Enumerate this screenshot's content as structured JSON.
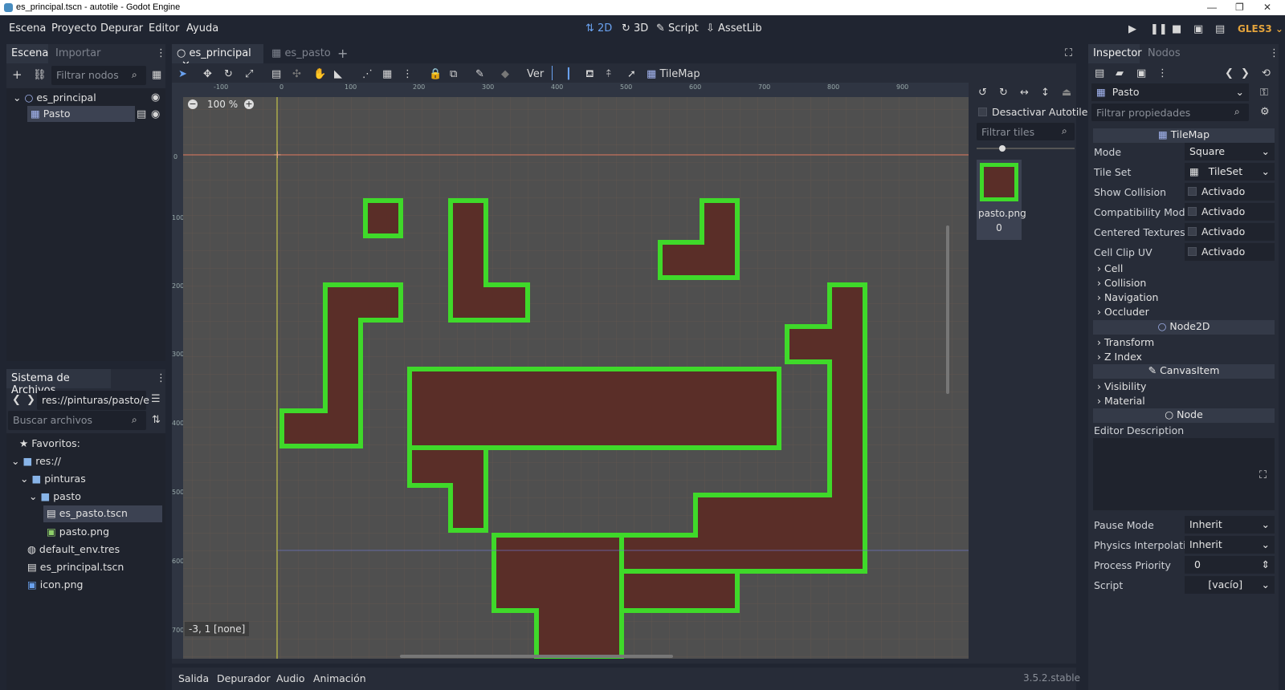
{
  "window": {
    "title": "es_principal.tscn - autotile - Godot Engine",
    "controls": [
      "—",
      "❐",
      "✕"
    ]
  },
  "menu": [
    "Escena",
    "Proyecto",
    "Depurar",
    "Editor",
    "Ayuda"
  ],
  "modes": [
    {
      "label": "2D",
      "icon": "2d-icon"
    },
    {
      "label": "3D",
      "icon": "3d-icon"
    },
    {
      "label": "Script",
      "icon": "script-icon"
    },
    {
      "label": "AssetLib",
      "icon": "assetlib-icon"
    }
  ],
  "renderer": "GLES3",
  "scene_dock": {
    "tabs": [
      "Escena",
      "Importar"
    ],
    "filter_placeholder": "Filtrar nodos",
    "nodes": [
      {
        "name": "es_principal",
        "icon": "node2d-icon"
      },
      {
        "name": "Pasto",
        "icon": "tilemap-icon"
      }
    ]
  },
  "filesystem": {
    "title": "Sistema de Archivos",
    "path": "res://pinturas/pasto/e",
    "search_placeholder": "Buscar archivos",
    "items": [
      {
        "label": "Favoritos:",
        "icon": "star-icon"
      },
      {
        "label": "res://",
        "icon": "folder-icon"
      },
      {
        "label": "pinturas",
        "icon": "folder-icon"
      },
      {
        "label": "pasto",
        "icon": "folder-icon"
      },
      {
        "label": "es_pasto.tscn",
        "icon": "scene-file-icon"
      },
      {
        "label": "pasto.png",
        "icon": "image-file-icon"
      },
      {
        "label": "default_env.tres",
        "icon": "environment-icon"
      },
      {
        "label": "es_principal.tscn",
        "icon": "scene-file-icon"
      },
      {
        "label": "icon.png",
        "icon": "image-file-icon"
      }
    ]
  },
  "editor_tabs": [
    "es_principal",
    "es_pasto"
  ],
  "toolbar": {
    "view_label": "Ver",
    "tilemap_label": "TileMap"
  },
  "viewport": {
    "zoom": "100 %",
    "status": "-3, 1 [none]",
    "ruler_h": [
      "-100",
      "0",
      "100",
      "200",
      "300",
      "400",
      "500",
      "600",
      "700",
      "800",
      "900"
    ],
    "ruler_v": [
      "0",
      "100",
      "200",
      "300",
      "400",
      "500",
      "600",
      "700"
    ]
  },
  "tile_palette": {
    "disable_autotile": "Desactivar Autotile",
    "filter_placeholder": "Filtrar tiles",
    "tile_label": "pasto.png 0"
  },
  "bottom": {
    "tabs": [
      "Salida",
      "Depurador",
      "Audio",
      "Animación"
    ],
    "version": "3.5.2.stable"
  },
  "inspector": {
    "tabs": [
      "Inspector",
      "Nodos"
    ],
    "object": "Pasto",
    "filter_placeholder": "Filtrar propiedades",
    "class_tilemap": "TileMap",
    "properties": [
      {
        "label": "Mode",
        "value": "Square"
      },
      {
        "label": "Tile Set",
        "value": "TileSet"
      },
      {
        "label": "Show Collision",
        "value": "Activado"
      },
      {
        "label": "Compatibility Mod",
        "value": "Activado"
      },
      {
        "label": "Centered Textures",
        "value": "Activado"
      },
      {
        "label": "Cell Clip UV",
        "value": "Activado"
      }
    ],
    "tilemap_groups": [
      "Cell",
      "Collision",
      "Navigation",
      "Occluder"
    ],
    "class_node2d": "Node2D",
    "node2d_groups": [
      "Transform",
      "Z Index"
    ],
    "class_canvasitem": "CanvasItem",
    "canvas_groups": [
      "Visibility",
      "Material"
    ],
    "class_node": "Node",
    "editor_description": "Editor Description",
    "node_props": [
      {
        "label": "Pause Mode",
        "value": "Inherit"
      },
      {
        "label": "Physics Interpolati",
        "value": "Inherit"
      },
      {
        "label": "Process Priority",
        "value": "0"
      },
      {
        "label": "Script",
        "value": "[vacío]"
      }
    ]
  },
  "colors": {
    "accent": "#6aa2f0",
    "grass": "#3fd92a",
    "dirt": "#5a2e28",
    "viewport_bg": "#4f4f4f"
  }
}
